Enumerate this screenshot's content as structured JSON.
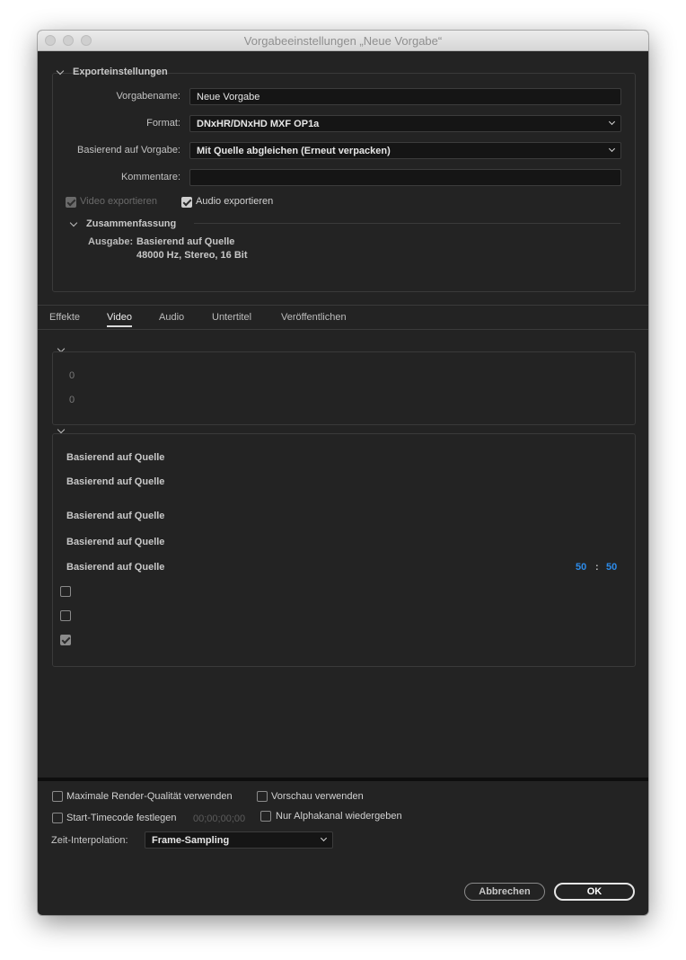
{
  "window": {
    "title": "Vorgabeeinstellungen „Neue Vorgabe“"
  },
  "export": {
    "section_title": "Exporteinstellungen",
    "preset_name_label": "Vorgabename:",
    "preset_name_value": "Neue Vorgabe",
    "format_label": "Format:",
    "format_value": "DNxHR/DNxHD MXF OP1a",
    "based_on_label": "Basierend auf Vorgabe:",
    "based_on_value": "Mit Quelle abgleichen (Erneut verpacken)",
    "comments_label": "Kommentare:",
    "comments_value": "",
    "export_video_label": "Video exportieren",
    "export_audio_label": "Audio exportieren",
    "summary": {
      "title": "Zusammenfassung",
      "output_label": "Ausgabe:",
      "output_line1": "Basierend auf Quelle",
      "output_line2": "48000 Hz, Stereo, 16 Bit"
    }
  },
  "tabs": [
    "Effekte",
    "Video",
    "Audio",
    "Untertitel",
    "Veröffentlichen"
  ],
  "active_tab": "Video",
  "video": {
    "group1_values": [
      "0",
      "0"
    ],
    "group2_values": [
      "Basierend auf Quelle",
      "Basierend auf Quelle",
      "Basierend auf Quelle",
      "Basierend auf Quelle",
      "Basierend auf Quelle"
    ],
    "aspect_left": "50",
    "aspect_sep": ":",
    "aspect_right": "50"
  },
  "bottom": {
    "max_render_quality": "Maximale Render-Qualität verwenden",
    "use_previews": "Vorschau verwenden",
    "set_start_timecode": "Start-Timecode festlegen",
    "timecode_value": "00;00;00;00",
    "alpha_only": "Nur Alphakanal wiedergeben",
    "time_interpolation_label": "Zeit-Interpolation:",
    "time_interpolation_value": "Frame-Sampling"
  },
  "buttons": {
    "cancel": "Abbrechen",
    "ok": "OK"
  },
  "colors": {
    "window_bg": "#232323",
    "accent_blue": "#2d8ceb"
  }
}
